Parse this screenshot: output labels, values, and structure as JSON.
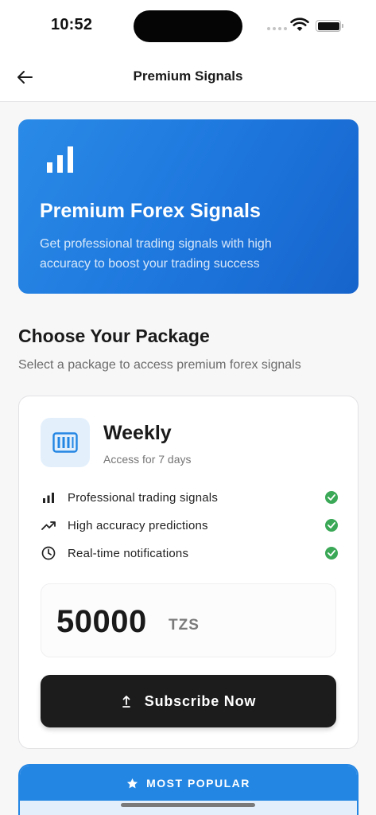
{
  "status_bar": {
    "time": "10:52"
  },
  "app_bar": {
    "title": "Premium Signals",
    "back_icon": "arrow-left-icon"
  },
  "hero": {
    "icon": "bar-chart-icon",
    "title": "Premium Forex Signals",
    "subtitle": "Get professional trading signals with high accuracy to boost your trading success"
  },
  "section": {
    "title": "Choose Your Package",
    "subtitle": "Select a package to access premium forex signals"
  },
  "package": {
    "icon": "calendar-week-icon",
    "name": "Weekly",
    "duration": "Access for 7 days",
    "features": [
      {
        "icon": "bar-chart-icon",
        "label": "Professional trading signals"
      },
      {
        "icon": "trending-up-icon",
        "label": "High accuracy predictions"
      },
      {
        "icon": "clock-icon",
        "label": "Real-time notifications"
      }
    ],
    "price": "50000",
    "currency": "TZS",
    "subscribe_label": "Subscribe Now"
  },
  "popular": {
    "label": "MOST POPULAR",
    "icon": "star-icon"
  },
  "colors": {
    "accent": "#2486e3",
    "hero_gradient_start": "#2a8ae6",
    "hero_gradient_end": "#1664cc",
    "success": "#3aa856",
    "button_dark": "#1c1c1c"
  }
}
